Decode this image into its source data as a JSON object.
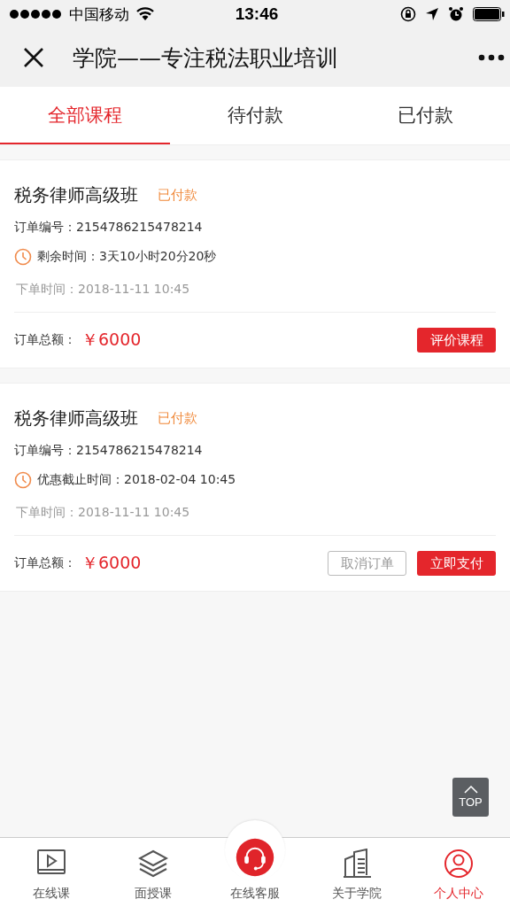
{
  "status_bar": {
    "carrier": "中国移动",
    "time": "13:46"
  },
  "header": {
    "title": "学院——专注税法职业培训"
  },
  "tabs": [
    {
      "label": "全部课程",
      "selected": true
    },
    {
      "label": "待付款",
      "selected": false
    },
    {
      "label": "已付款",
      "selected": false
    }
  ],
  "orders": [
    {
      "title": "税务律师高级班",
      "status": "已付款",
      "order_no": "订单编号：2154786215478214",
      "time_note": "剩余时间：3天10小时20分20秒",
      "placed": "下单时间：2018-11-11  10:45",
      "total_label": "订单总额：",
      "amount": "￥6000",
      "buttons": [
        {
          "label": "评价课程",
          "kind": "primary"
        }
      ]
    },
    {
      "title": "税务律师高级班",
      "status": "已付款",
      "order_no": "订单编号：2154786215478214",
      "time_note": "优惠截止时间：2018-02-04 10:45",
      "placed": "下单时间：2018-11-11  10:45",
      "total_label": "订单总额：",
      "amount": "￥6000",
      "buttons": [
        {
          "label": "取消订单",
          "kind": "outline"
        },
        {
          "label": "立即支付",
          "kind": "primary"
        }
      ]
    }
  ],
  "top_button": {
    "label": "TOP"
  },
  "bottom_nav": [
    {
      "label": "在线课",
      "kind": "tab",
      "selected": false
    },
    {
      "label": "面授课",
      "kind": "tab",
      "selected": false
    },
    {
      "label": "在线客服",
      "kind": "center",
      "selected": false
    },
    {
      "label": "关于学院",
      "kind": "tab",
      "selected": false
    },
    {
      "label": "个人中心",
      "kind": "tab",
      "selected": true
    }
  ]
}
